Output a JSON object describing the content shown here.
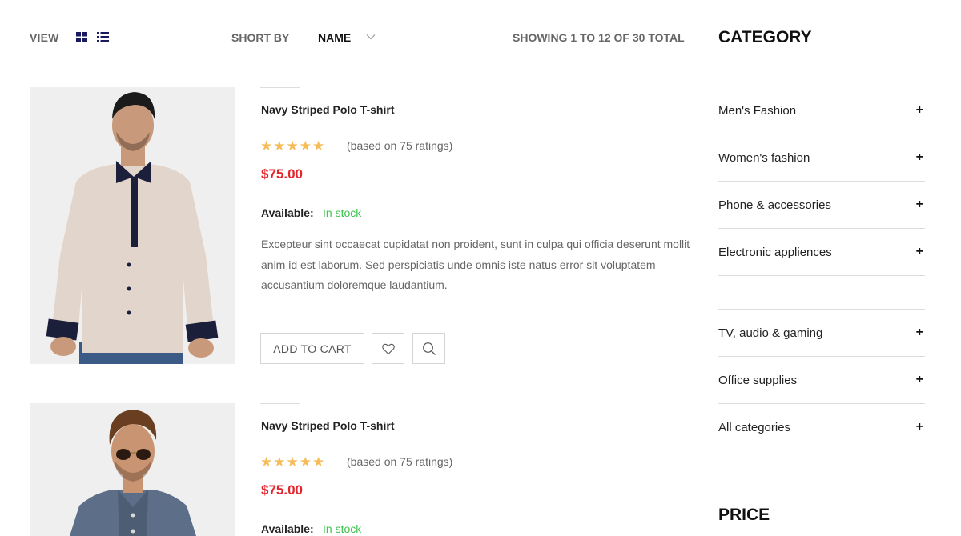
{
  "toolbar": {
    "view_label": "VIEW",
    "sort_label": "SHORT BY",
    "sort_value": "NAME",
    "showing_text": "SHOWING 1 TO 12 OF 30 TOTAL",
    "icons": [
      "grid-view-icon",
      "list-view-icon",
      "chevron-down-icon"
    ]
  },
  "products": [
    {
      "title": "Navy Striped Polo T-shirt",
      "stars": "★★★★★",
      "rating": 5,
      "ratings_text": "(based on 75 ratings)",
      "price": "$75.00",
      "available_label": "Available:",
      "available_value": "In stock",
      "description": "Excepteur sint occaecat cupidatat non proident, sunt in culpa qui officia deserunt mollit anim id est laborum. Sed perspiciatis unde omnis iste natus error sit voluptatem accusantium doloremque laudantium.",
      "add_to_cart": "ADD TO CART",
      "image": "man-in-beige-shirt-photo"
    },
    {
      "title": "Navy Striped Polo T-shirt",
      "stars": "★★★★★",
      "rating": 5,
      "ratings_text": "(based on 75 ratings)",
      "price": "$75.00",
      "available_label": "Available:",
      "available_value": "In stock",
      "image": "man-in-denim-shirt-sunglasses-photo"
    }
  ],
  "sidebar": {
    "category_heading": "CATEGORY",
    "categories": [
      {
        "label": "Men's Fashion",
        "icon": "plus-icon"
      },
      {
        "label": "Women's fashion",
        "icon": "plus-icon"
      },
      {
        "label": "Phone & accessories",
        "icon": "plus-icon"
      },
      {
        "label": "Electronic appliences",
        "icon": "plus-icon"
      },
      {
        "label": "TV, audio & gaming",
        "icon": "plus-icon"
      },
      {
        "label": "Office supplies",
        "icon": "plus-icon"
      },
      {
        "label": "All categories",
        "icon": "plus-icon"
      }
    ],
    "plus_glyph": "+",
    "price_heading": "PRICE"
  },
  "colors": {
    "price": "#e3262d",
    "in_stock": "#3ec24f",
    "stars": "#f5bc58",
    "muted_text": "#666666"
  }
}
